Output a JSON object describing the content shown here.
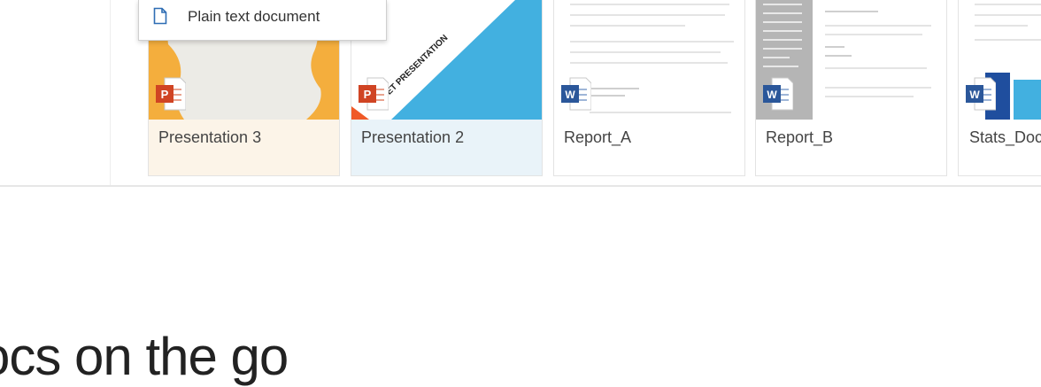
{
  "menu": {
    "items": [
      {
        "label": "Plain text document",
        "icon": "document-outline-icon"
      }
    ]
  },
  "files": [
    {
      "name": "Presentation 3",
      "type": "powerpoint",
      "icon": "powerpoint-file-icon"
    },
    {
      "name": "Presentation 2",
      "type": "powerpoint",
      "icon": "powerpoint-file-icon",
      "thumb_text": "SET PRESENTATION"
    },
    {
      "name": "Report_A",
      "type": "word",
      "icon": "word-file-icon"
    },
    {
      "name": "Report_B",
      "type": "word",
      "icon": "word-file-icon"
    },
    {
      "name": "Stats_Doc",
      "type": "word",
      "icon": "word-file-icon"
    }
  ],
  "tagline": "ocs on the go",
  "colors": {
    "powerpoint": "#d04423",
    "word": "#2b579a",
    "accent_blue": "#2e6db4",
    "orange": "#f4ae3d",
    "sky": "#42b0e0"
  }
}
